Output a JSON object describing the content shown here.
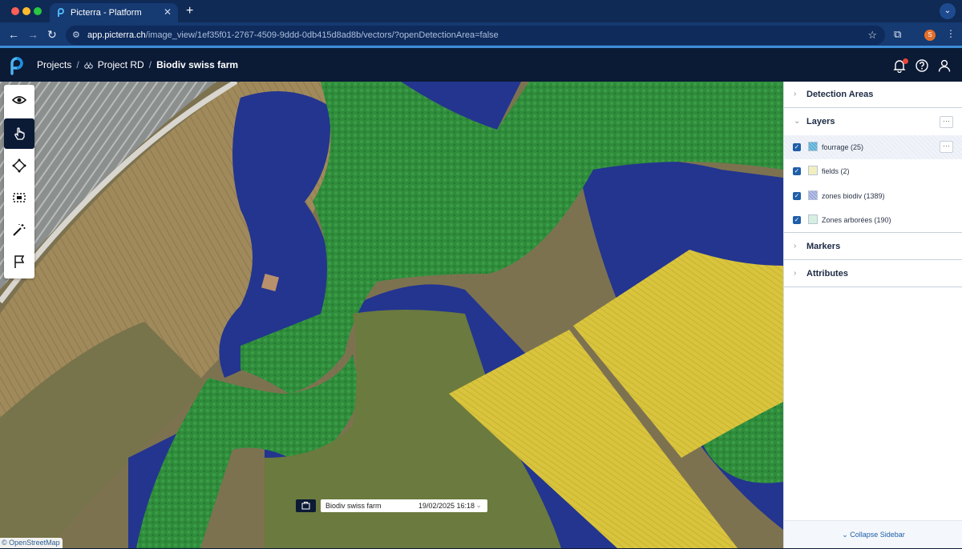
{
  "browser": {
    "tab_title": "Picterra - Platform",
    "tab_close": "✕",
    "new_tab": "+",
    "url_host": "app.picterra.ch",
    "url_path": "/image_view/1ef35f01-2767-4509-9ddd-0db415d8ad8b/vectors/?openDetectionArea=false",
    "profile_initial": "S"
  },
  "header": {
    "crumbs": [
      "Projects",
      "Project RD",
      "Biodiv swiss farm"
    ],
    "separator": "/"
  },
  "toolbar": {
    "tools": [
      "eye-icon",
      "hand-pointer-icon",
      "polygon-icon",
      "selection-icon",
      "magic-wand-icon",
      "flag-icon"
    ],
    "active": "hand-pointer-icon"
  },
  "map": {
    "image_name": "Biodiv swiss farm",
    "image_date": "19/02/2025 16:18",
    "attribution": "© OpenStreetMap",
    "colors": {
      "fourrage": "#23358f",
      "fields": "#c9c23a",
      "zones_biodiv": "#2a8a3a"
    }
  },
  "sidebar": {
    "detection_areas": "Detection Areas",
    "layers_title": "Layers",
    "layers": [
      {
        "name": "fourrage (25)",
        "swatch": "#7fc4e0",
        "checked": true
      },
      {
        "name": "fields (2)",
        "swatch": "#f2efbf",
        "checked": true
      },
      {
        "name": "zones biodiv (1389)",
        "swatch": "#b9c2e8",
        "checked": true
      },
      {
        "name": "Zones arborées (190)",
        "swatch": "#d6efe1",
        "checked": true
      }
    ],
    "markers": "Markers",
    "attributes": "Attributes",
    "collapse": "Collapse Sidebar",
    "more": "···"
  }
}
